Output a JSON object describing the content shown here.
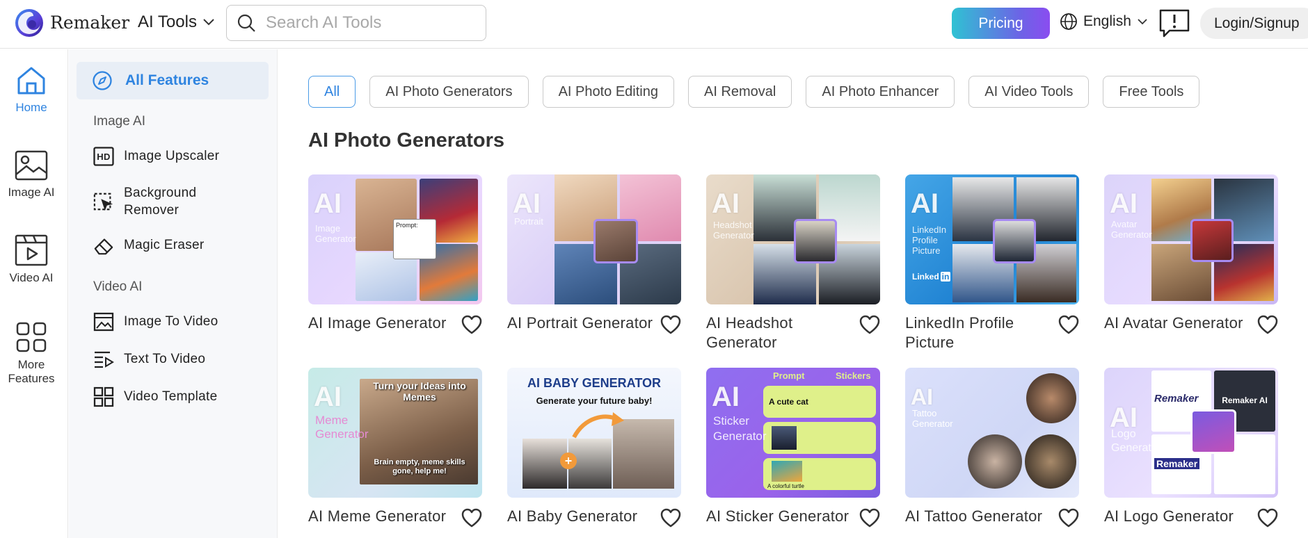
{
  "header": {
    "brand": "Remaker",
    "tools_menu": "AI Tools",
    "search_placeholder": "Search AI Tools",
    "pricing": "Pricing",
    "language": "English",
    "login": "Login/Signup"
  },
  "rail": {
    "home": "Home",
    "image_ai": "Image AI",
    "video_ai": "Video AI",
    "more_1": "More",
    "more_2": "Features"
  },
  "subnav": {
    "all_features": "All Features",
    "image_head": "Image AI",
    "image_upscaler": "Image Upscaler",
    "background_remover_1": "Background",
    "background_remover_2": "Remover",
    "magic_eraser": "Magic Eraser",
    "video_head": "Video AI",
    "image_to_video": "Image To Video",
    "text_to_video": "Text To Video",
    "video_template": "Video Template"
  },
  "filters": [
    "All",
    "AI Photo Generators",
    "AI Photo Editing",
    "AI Removal",
    "AI Photo Enhancer",
    "AI Video Tools",
    "Free Tools"
  ],
  "section_title": "AI Photo Generators",
  "cards": [
    {
      "title": "AI Image Generator",
      "thumb_big": "AI",
      "thumb_small": "Image Generator",
      "bg": "linear-gradient(135deg,#d9d2fb,#e9d8ff 60%,#f3c8ef)"
    },
    {
      "title": "AI Portrait Generator",
      "thumb_big": "AI",
      "thumb_small": "Portrait",
      "bg": "linear-gradient(135deg,#ece6fb,#d8ccf7 60%,#efe2fb)"
    },
    {
      "title": "AI Headshot Generator",
      "thumb_big": "AI",
      "thumb_small": "Headshot Generator",
      "bg": "linear-gradient(135deg,#e9dccb,#d9c5ae 60%,#eee2d3)"
    },
    {
      "title": "LinkedIn Profile Picture",
      "thumb_big": "AI",
      "thumb_small": "LinkedIn Profile Picture",
      "bg": "linear-gradient(135deg,#45a6e7,#1f82d2 60%,#4fb3ee)"
    },
    {
      "title": "AI Avatar Generator",
      "thumb_big": "AI",
      "thumb_small": "Avatar Generator",
      "bg": "linear-gradient(135deg,#dcd4fa,#e8dcff 60%,#c9b6f4)"
    },
    {
      "title": "AI Meme Generator",
      "thumb_big": "AI",
      "thumb_small": "Meme Generator",
      "bg": "linear-gradient(135deg,#c6ebe7,#d7e5f3 60%,#bfe5ef)"
    },
    {
      "title": "AI Baby Generator",
      "thumb_big": "",
      "thumb_small": "",
      "bg": "linear-gradient(180deg,#f4f7fd,#dfe9fb)"
    },
    {
      "title": "AI Sticker Generator",
      "thumb_big": "AI",
      "thumb_small": "Sticker Generator",
      "bg": "linear-gradient(135deg,#8f6ff0,#9a62ea 60%,#7a5de0)"
    },
    {
      "title": "AI Tattoo Generator",
      "thumb_big": "AI",
      "thumb_small": "Tattoo Generator",
      "bg": "linear-gradient(135deg,#dbe0fb,#cfd7f6 60%,#e4e9fb)"
    },
    {
      "title": "AI Logo Generator",
      "thumb_big": "AI",
      "thumb_small": "Logo Generator",
      "bg": "linear-gradient(135deg,#dcd4fb,#ebe1ff 60%,#d3c3f8)"
    }
  ],
  "thumb_text": {
    "prompt": "Prompt:",
    "meme_top": "Turn your Ideas into Memes",
    "meme_bottom": "Brain empty, meme skills gone, help me!",
    "baby_title": "AI BABY GENERATOR",
    "baby_sub": "Generate your future baby!",
    "sticker_prompt": "Prompt",
    "sticker_stickers": "Stickers",
    "sticker_cat": "A cute cat",
    "sticker_turtle": "A colorful turtle",
    "linkedin": "Linked",
    "logo_1": "Remaker",
    "logo_2": "Remaker AI",
    "logo_3": "Remaker"
  },
  "colors": {
    "accent": "#2f84e0",
    "pricing_start": "#2fc2d3",
    "pricing_end": "#8a4df0"
  }
}
